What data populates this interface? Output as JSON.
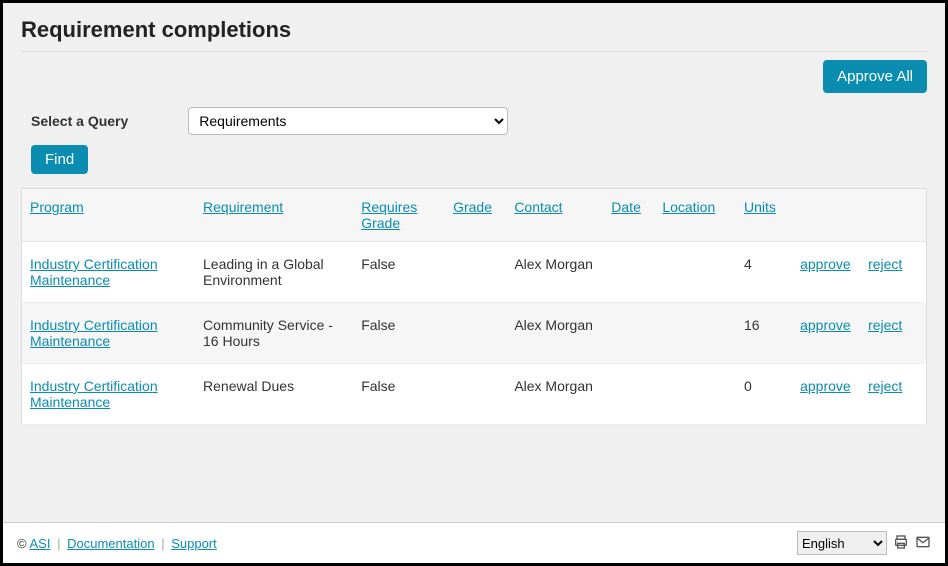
{
  "page": {
    "title": "Requirement completions"
  },
  "actions": {
    "approve_all": "Approve All"
  },
  "query": {
    "label": "Select a Query",
    "selected": "Requirements",
    "find_label": "Find"
  },
  "table": {
    "headers": {
      "program": "Program",
      "requirement": "Requirement",
      "requires_grade": "Requires Grade",
      "grade": "Grade",
      "contact": "Contact",
      "date": "Date",
      "location": "Location",
      "units": "Units"
    },
    "row_actions": {
      "approve": "approve",
      "reject": "reject"
    },
    "rows": [
      {
        "program": "Industry Certification Maintenance",
        "requirement": "Leading in a Global Environment",
        "requires_grade": "False",
        "grade": "",
        "contact": "Alex Morgan",
        "date": "",
        "location": "",
        "units": "4"
      },
      {
        "program": "Industry Certification Maintenance",
        "requirement": "Community Service - 16 Hours",
        "requires_grade": "False",
        "grade": "",
        "contact": "Alex Morgan",
        "date": "",
        "location": "",
        "units": "16"
      },
      {
        "program": "Industry Certification Maintenance",
        "requirement": "Renewal Dues",
        "requires_grade": "False",
        "grade": "",
        "contact": "Alex Morgan",
        "date": "",
        "location": "",
        "units": "0"
      }
    ]
  },
  "footer": {
    "copyright": "©",
    "asi": "ASI",
    "documentation": "Documentation",
    "support": "Support",
    "language": "English"
  }
}
